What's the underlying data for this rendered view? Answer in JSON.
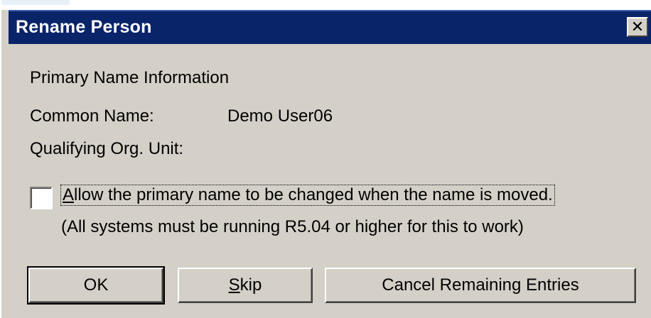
{
  "window": {
    "title": "Rename Person",
    "close_glyph": "✕"
  },
  "section": {
    "title": "Primary Name Information"
  },
  "fields": {
    "common_name_label": "Common Name:",
    "common_name_value": "Demo User06",
    "qualifying_ou_label": "Qualifying Org. Unit:",
    "qualifying_ou_value": ""
  },
  "option": {
    "checked": false,
    "label_first_char": "A",
    "label_rest": "llow the primary name to be changed when the name is moved.",
    "note": "(All systems must be running R5.04 or higher for this to work)"
  },
  "buttons": {
    "ok": "OK",
    "skip_first_char": "S",
    "skip_rest": "kip",
    "cancel_remaining": "Cancel Remaining Entries"
  },
  "colors": {
    "titlebar": "#0a246a",
    "face": "#d4d0c8"
  }
}
